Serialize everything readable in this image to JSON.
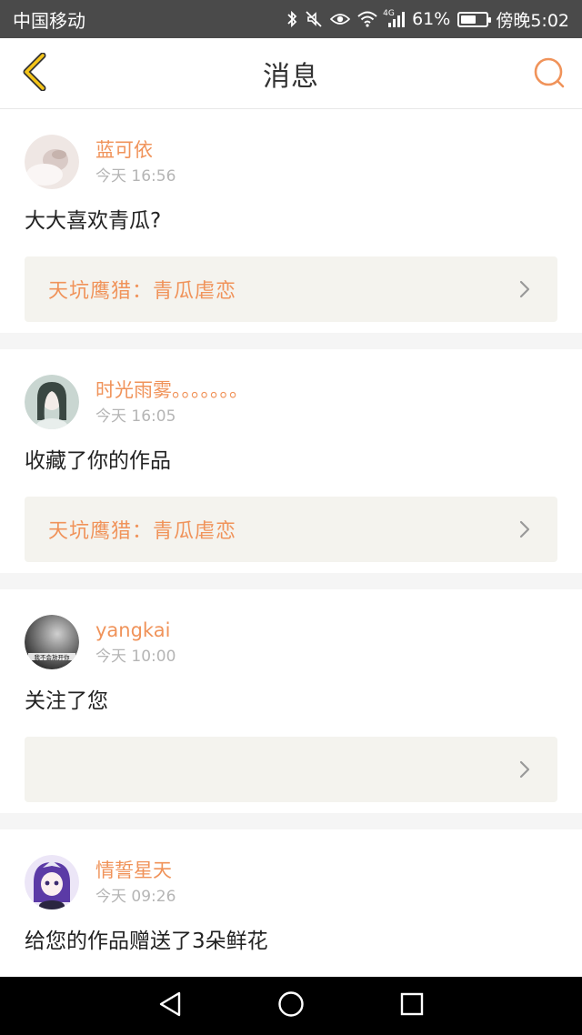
{
  "status_bar": {
    "carrier": "中国移动",
    "network": "4G",
    "battery_text": "61%",
    "battery_level": 0.61,
    "clock": "傍晚5:02"
  },
  "header": {
    "title": "消息",
    "accent_color": "#f0935a",
    "back_icon": "chevron-left-icon",
    "search_icon": "search-icon"
  },
  "messages": [
    {
      "username": "蓝可依",
      "time": "今天 16:56",
      "text": "大大喜欢青瓜?",
      "work": "天坑鹰猎：青瓜虐恋"
    },
    {
      "username": "时光雨雾。。。。。。。",
      "time": "今天 16:05",
      "text": "收藏了你的作品",
      "work": "天坑鹰猎：青瓜虐恋"
    },
    {
      "username": "yangkai",
      "time": "今天 10:00",
      "text": "关注了您",
      "work": "",
      "avatar_caption": "我不会放开你"
    },
    {
      "username": "情誓星天",
      "time": "今天 09:26",
      "text": "给您的作品赠送了3朵鲜花",
      "work": ""
    }
  ],
  "nav": {
    "back_icon": "triangle-back-icon",
    "home_icon": "circle-home-icon",
    "recents_icon": "square-recents-icon"
  }
}
